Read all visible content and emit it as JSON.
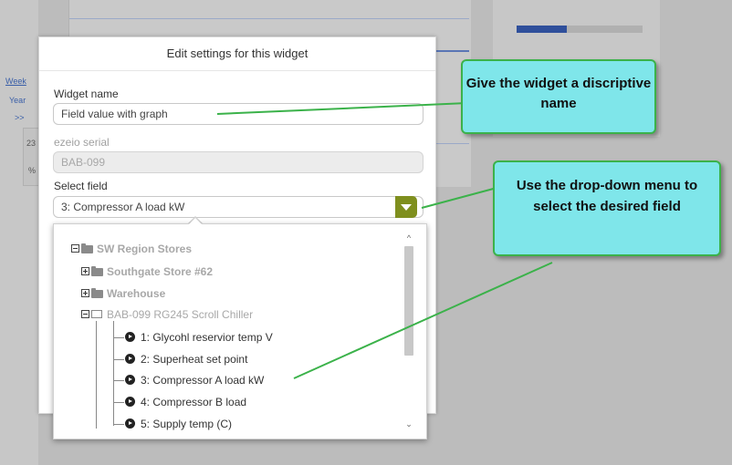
{
  "background": {
    "left_links": [
      "Week",
      "Year",
      ">>"
    ],
    "left_numbers": [
      "23",
      "%"
    ]
  },
  "dialog": {
    "title": "Edit settings for this widget",
    "widget_name": {
      "label": "Widget name",
      "value": "Field value with graph"
    },
    "serial": {
      "label": "ezeio serial",
      "value": "BAB-099"
    },
    "select_field": {
      "label": "Select field",
      "value": "3: Compressor A load kW"
    }
  },
  "tree": {
    "root": "SW Region Stores",
    "groups": [
      "Southgate Store #62",
      "Warehouse"
    ],
    "device": "BAB-099 RG245 Scroll Chiller",
    "fields": [
      "1: Glycohl reservior temp V",
      "2: Superheat set point",
      "3: Compressor A load kW",
      "4: Compressor B load",
      "5: Supply temp (C)"
    ]
  },
  "callouts": {
    "name_tip": "Give the widget a discriptive name",
    "dropdown_tip": "Use the drop-down menu to select the desired field"
  },
  "colors": {
    "accent_green": "#7f8f1e",
    "callout_fill": "#7fe6ea",
    "callout_border": "#3bb24a"
  },
  "icons": {
    "dropdown": "triangle-down-icon",
    "expand": "plus-box-icon",
    "collapse": "minus-box-icon",
    "folder": "folder-icon",
    "field": "circle-arrow-icon"
  }
}
